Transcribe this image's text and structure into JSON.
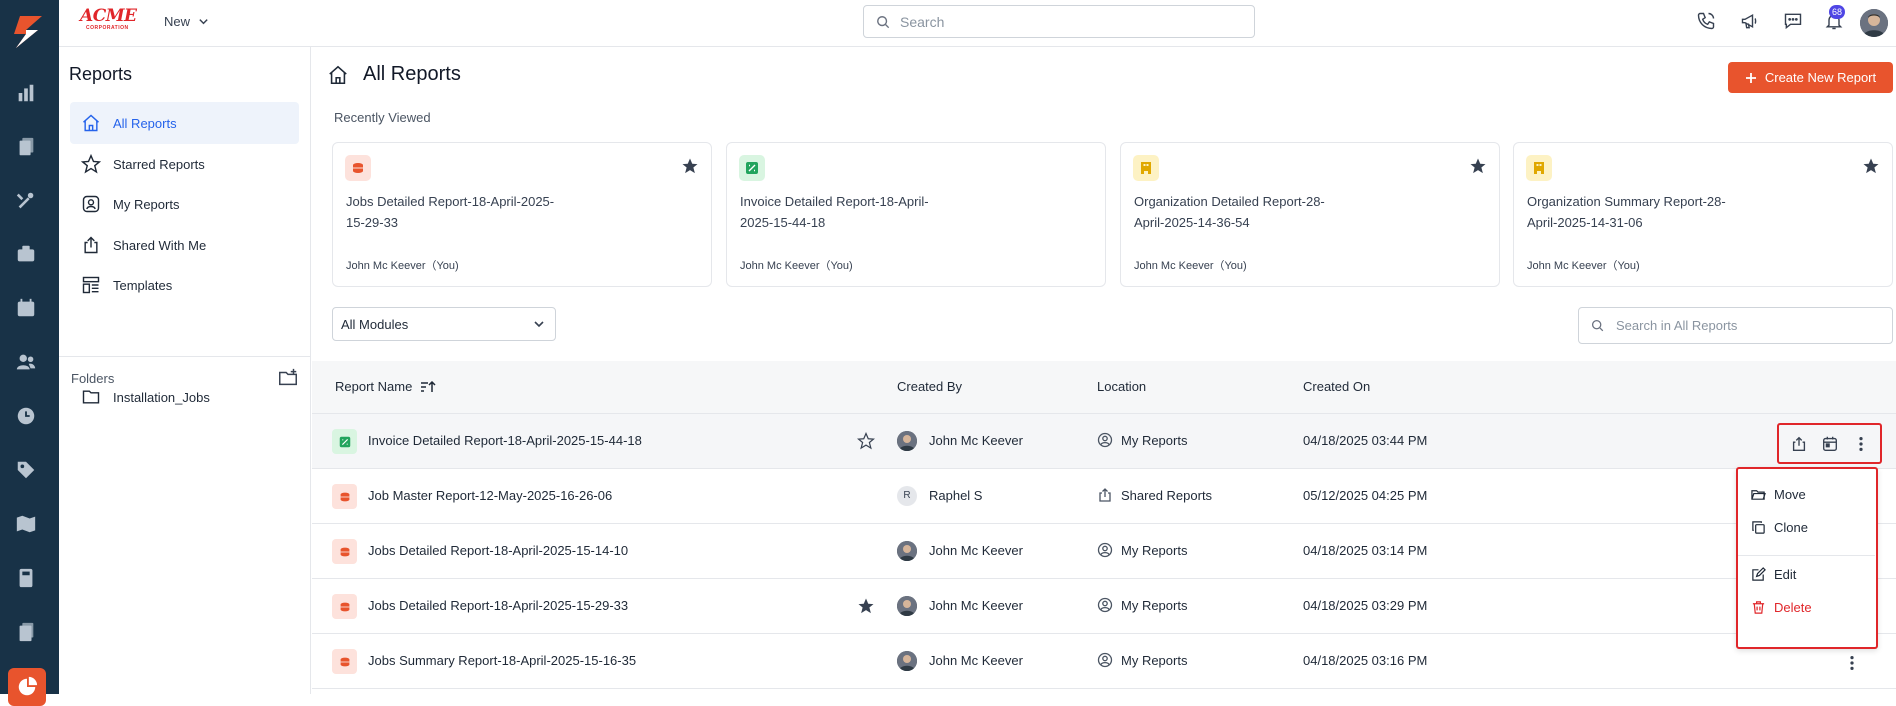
{
  "brand": {
    "name": "ACME",
    "sub": "CORPORATION"
  },
  "topbar": {
    "new_label": "New",
    "search_placeholder": "Search",
    "notifications_count": "68"
  },
  "sidebar": {
    "title": "Reports",
    "items": [
      {
        "label": "All Reports",
        "icon": "home-icon"
      },
      {
        "label": "Starred Reports",
        "icon": "star-icon"
      },
      {
        "label": "My Reports",
        "icon": "user-icon"
      },
      {
        "label": "Shared With Me",
        "icon": "share-icon"
      },
      {
        "label": "Templates",
        "icon": "template-icon"
      }
    ],
    "folders_label": "Folders",
    "folders": [
      {
        "label": "Installation_Jobs"
      }
    ]
  },
  "main": {
    "title": "All Reports",
    "create_label": "Create New Report",
    "recent_label": "Recently Viewed",
    "recent": [
      {
        "title": "Jobs Detailed Report-18-April-2025-15-29-33",
        "by": "John Mc Keever（You)",
        "type": "jobs",
        "starred": true
      },
      {
        "title": "Invoice Detailed Report-18-April-2025-15-44-18",
        "by": "John Mc Keever（You)",
        "type": "invoice",
        "starred": false
      },
      {
        "title": "Organization Detailed Report-28-April-2025-14-36-54",
        "by": "John Mc Keever（You)",
        "type": "org",
        "starred": true
      },
      {
        "title": "Organization Summary Report-28-April-2025-14-31-06",
        "by": "John Mc Keever（You)",
        "type": "org",
        "starred": true
      }
    ],
    "module_filter": "All Modules",
    "table_search_placeholder": "Search in All Reports",
    "columns": {
      "name": "Report Name",
      "by": "Created By",
      "location": "Location",
      "created": "Created On"
    },
    "rows": [
      {
        "name": "Invoice Detailed Report-18-April-2025-15-44-18",
        "by": "John Mc Keever",
        "location": "My Reports",
        "created": "04/18/2025 03:44 PM",
        "type": "invoice",
        "star": "outline"
      },
      {
        "name": "Job Master Report-12-May-2025-16-26-06",
        "by": "Raphel S",
        "initial": "R",
        "location": "Shared Reports",
        "created": "05/12/2025 04:25 PM",
        "type": "jobs",
        "star": "none"
      },
      {
        "name": "Jobs Detailed Report-18-April-2025-15-14-10",
        "by": "John Mc Keever",
        "location": "My Reports",
        "created": "04/18/2025 03:14 PM",
        "type": "jobs",
        "star": "none"
      },
      {
        "name": "Jobs Detailed Report-18-April-2025-15-29-33",
        "by": "John Mc Keever",
        "location": "My Reports",
        "created": "04/18/2025 03:29 PM",
        "type": "jobs",
        "star": "filled"
      },
      {
        "name": "Jobs Summary Report-18-April-2025-15-16-35",
        "by": "John Mc Keever",
        "location": "My Reports",
        "created": "04/18/2025 03:16 PM",
        "type": "jobs",
        "star": "none"
      }
    ],
    "menu": {
      "move": "Move",
      "clone": "Clone",
      "edit": "Edit",
      "delete": "Delete"
    }
  },
  "colors": {
    "accent": "#e8542d",
    "rail": "#183247",
    "active_blue": "#2563eb",
    "danger": "#e0262a"
  }
}
